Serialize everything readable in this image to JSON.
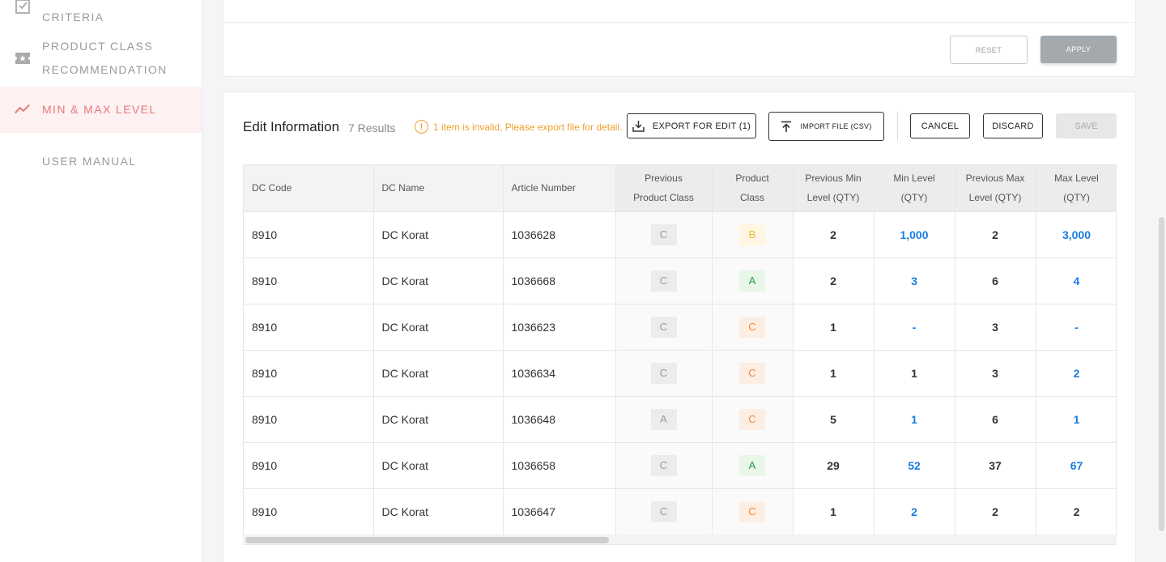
{
  "sidebar": {
    "items": [
      {
        "label": "CRITERIA",
        "icon": "checkbox-icon"
      },
      {
        "label": "PRODUCT CLASS",
        "label2": "RECOMMENDATION",
        "icon": "ticket-star-icon"
      },
      {
        "label": "MIN & MAX LEVEL",
        "icon": "trend-icon",
        "active": true
      },
      {
        "label": "USER MANUAL"
      }
    ]
  },
  "filter": {
    "reset_label": "RESET",
    "apply_label": "APPLY"
  },
  "edit": {
    "title": "Edit Information",
    "count": "7 Results",
    "warning": "1 item is invalid, Please export file for detail.",
    "export_label": "EXPORT FOR EDIT (1)",
    "import_label": "IMPORT FILE (CSV)",
    "cancel_label": "CANCEL",
    "discard_label": "DISCARD",
    "save_label": "SAVE"
  },
  "table": {
    "headers": {
      "dc_code": "DC Code",
      "dc_name": "DC Name",
      "article": "Article Number",
      "prev_class_1": "Previous",
      "prev_class_2": "Product Class",
      "class_1": "Product",
      "class_2": "Class",
      "prev_min_1": "Previous Min",
      "prev_min_2": "Level (QTY)",
      "min_1": "Min Level",
      "min_2": "(QTY)",
      "prev_max_1": "Previous Max",
      "prev_max_2": "Level (QTY)",
      "max_1": "Max Level",
      "max_2": "(QTY)"
    },
    "rows": [
      {
        "dc_code": "8910",
        "dc_name": "DC Korat",
        "article": "1036628",
        "prev_class": "C",
        "class": "B",
        "prev_min": "2",
        "min": "1,000",
        "prev_max": "2",
        "max": "3,000",
        "min_blue": true,
        "max_blue": true
      },
      {
        "dc_code": "8910",
        "dc_name": "DC Korat",
        "article": "1036668",
        "prev_class": "C",
        "class": "A",
        "prev_min": "2",
        "min": "3",
        "prev_max": "6",
        "max": "4",
        "min_blue": true,
        "max_blue": true
      },
      {
        "dc_code": "8910",
        "dc_name": "DC Korat",
        "article": "1036623",
        "prev_class": "C",
        "class": "C",
        "prev_min": "1",
        "min": "-",
        "prev_max": "3",
        "max": "-",
        "min_blue": true,
        "max_blue": true
      },
      {
        "dc_code": "8910",
        "dc_name": "DC Korat",
        "article": "1036634",
        "prev_class": "C",
        "class": "C",
        "prev_min": "1",
        "min": "1",
        "prev_max": "3",
        "max": "2",
        "min_blue": false,
        "max_blue": true
      },
      {
        "dc_code": "8910",
        "dc_name": "DC Korat",
        "article": "1036648",
        "prev_class": "A",
        "class": "C",
        "prev_min": "5",
        "min": "1",
        "prev_max": "6",
        "max": "1",
        "min_blue": true,
        "max_blue": true
      },
      {
        "dc_code": "8910",
        "dc_name": "DC Korat",
        "article": "1036658",
        "prev_class": "C",
        "class": "A",
        "prev_min": "29",
        "min": "52",
        "prev_max": "37",
        "max": "67",
        "min_blue": true,
        "max_blue": true
      },
      {
        "dc_code": "8910",
        "dc_name": "DC Korat",
        "article": "1036647",
        "prev_class": "C",
        "class": "C",
        "prev_min": "1",
        "min": "2",
        "prev_max": "2",
        "max": "2",
        "min_blue": true,
        "max_blue": false
      }
    ]
  },
  "colors": {
    "accent": "#e8797c",
    "blue_value": "#1a7ce0",
    "warning": "#f0a030"
  }
}
